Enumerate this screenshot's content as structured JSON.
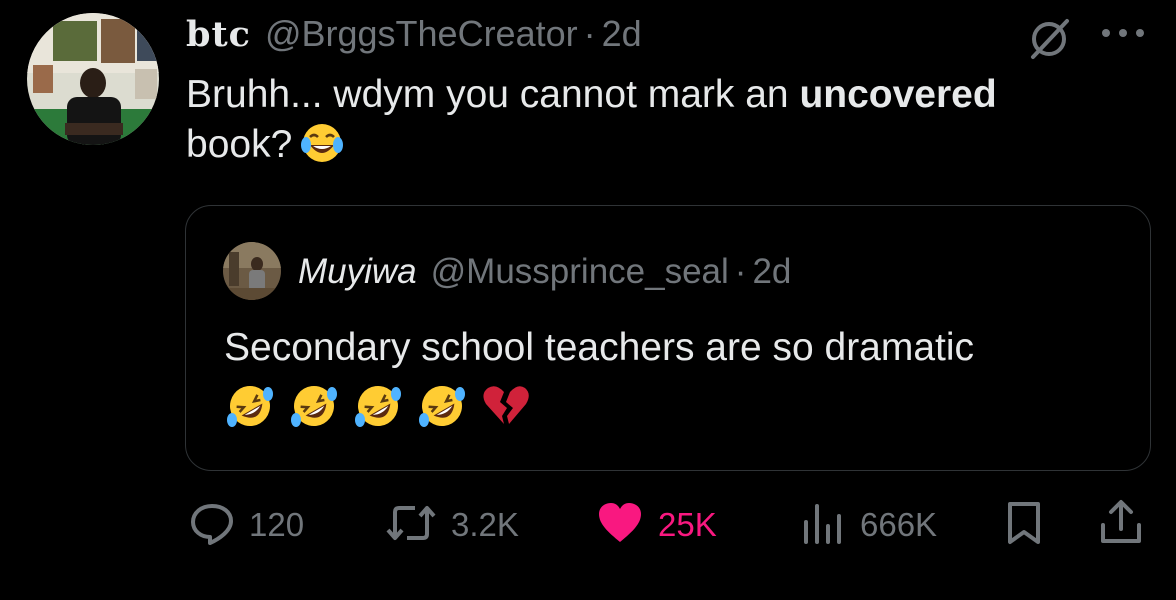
{
  "tweet": {
    "display_name": "btc",
    "handle": "@BrggsTheCreator",
    "separator": "·",
    "time": "2d",
    "text_before": "Bruhh... wdym you cannot mark an ",
    "text_bold": "uncovered",
    "text_after": "book?",
    "emoji": "face-with-tears-of-joy"
  },
  "quote": {
    "display_name": "Muyiwa",
    "handle": "@Mussprince_seal",
    "separator": "·",
    "time": "2d",
    "text": "Secondary school teachers are so dramatic",
    "emojis": [
      "rolling-on-floor-laughing",
      "rolling-on-floor-laughing",
      "rolling-on-floor-laughing",
      "rolling-on-floor-laughing",
      "broken-heart"
    ]
  },
  "actions": {
    "replies": "120",
    "reposts": "3.2K",
    "likes": "25K",
    "views": "666K"
  },
  "icons": {
    "reply": "speech-bubble-icon",
    "repost": "repost-arrows-icon",
    "like": "heart-icon",
    "views": "bar-chart-icon",
    "bookmark": "bookmark-icon",
    "share": "share-icon",
    "grok": "grok-icon",
    "more": "more-dots-icon"
  },
  "colors": {
    "background": "#000000",
    "text": "#e7e9ea",
    "muted": "#71767b",
    "like": "#f91880",
    "border": "#2f3336"
  }
}
